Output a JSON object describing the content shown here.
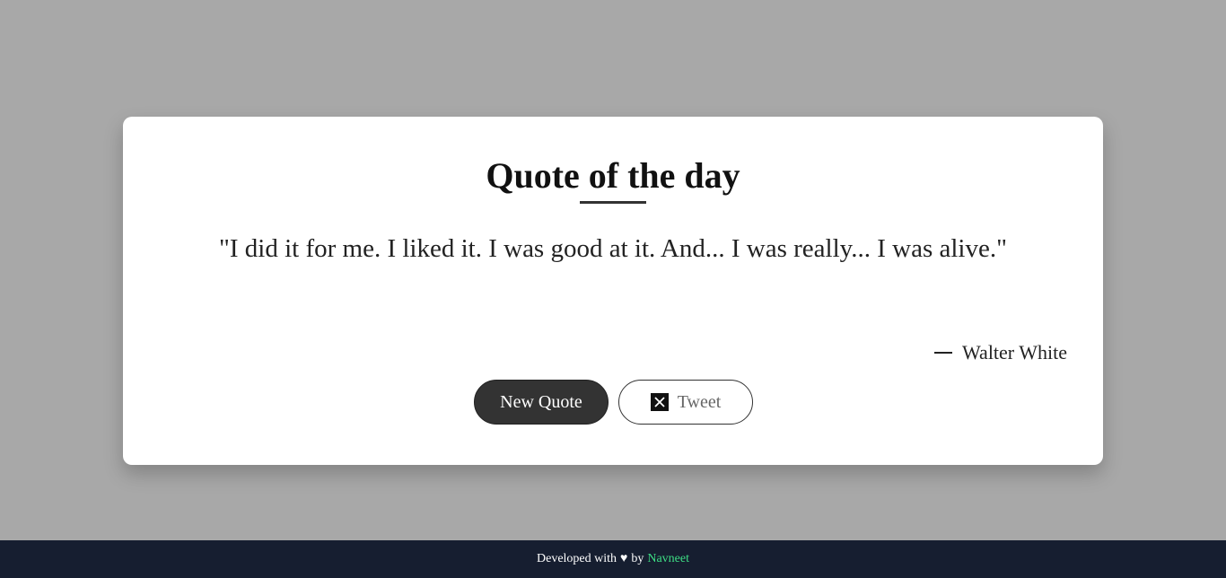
{
  "card": {
    "title": "Quote of the day",
    "quote": "\"I did it for me. I liked it. I was good at it. And... I was really... I was alive.\"",
    "author": "Walter White"
  },
  "actions": {
    "new_quote_label": "New Quote",
    "tweet_label": "Tweet",
    "tweet_icon": "x-logo-icon"
  },
  "footer": {
    "prefix": "Developed with",
    "heart": "♥",
    "by": "by",
    "author_link": "Navneet"
  },
  "colors": {
    "page_background": "#a8a8a8",
    "card_background": "#ffffff",
    "primary_button": "#333333",
    "footer_background": "#161e30",
    "footer_link": "#3ddc84"
  }
}
